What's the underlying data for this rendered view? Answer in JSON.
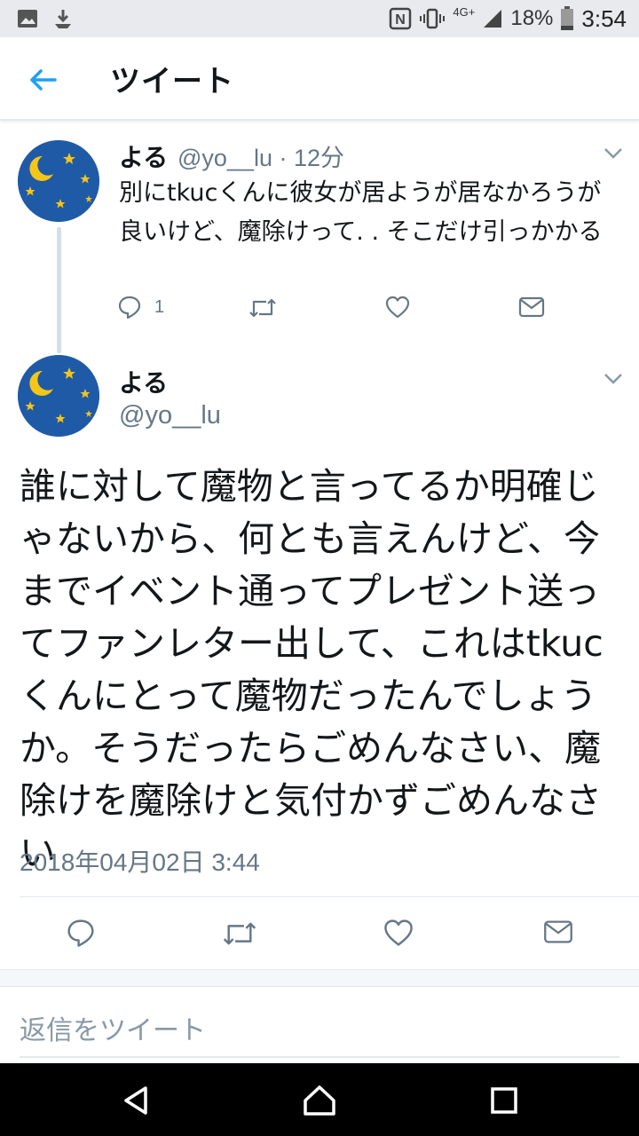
{
  "status_bar": {
    "network": "4G+",
    "battery": "18%",
    "time": "3:54"
  },
  "header": {
    "title": "ツイート"
  },
  "parent_tweet": {
    "name": "よる",
    "handle": "@yo__lu · 12分",
    "text": "別にtkucくんに彼女が居ようが居なかろうが良いけど、魔除けって. . そこだけ引っかかる",
    "reply_count": "1"
  },
  "main_tweet": {
    "name": "よる",
    "handle": "@yo__lu",
    "text": "誰に対して魔物と言ってるか明確じゃないから、何とも言えんけど、今までイベント通ってプレゼント送ってファンレター出して、これはtkucくんにとって魔物だったんでしょうか。そうだったらごめんなさい、魔除けを魔除けと気付かずごめんなさい",
    "date": "2018年04月02日 3:44"
  },
  "reply": {
    "placeholder": "返信をツイート"
  },
  "colors": {
    "accent": "#1da1f2",
    "avatar_bg": "#1f5aa6",
    "star": "#f5c518",
    "icon_gray": "#657786"
  }
}
